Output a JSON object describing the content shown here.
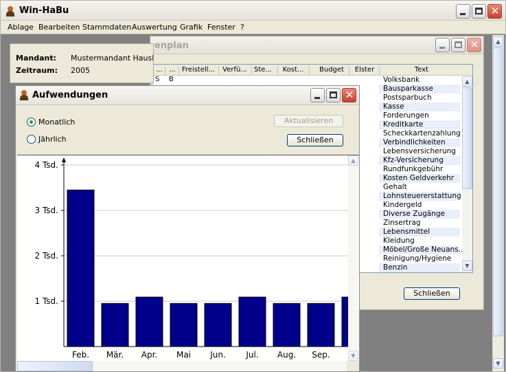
{
  "app": {
    "title": "Win-HaBu",
    "menu": [
      "Ablage",
      "Bearbeiten",
      "Stammdaten",
      "Auswertung",
      "Grafik",
      "Fenster",
      "?"
    ]
  },
  "info": {
    "mandant_label": "Mandant:",
    "mandant_value": "Mustermandant Haushalt",
    "zeitraum_label": "Zeitraum:",
    "zeitraum_value": "2005"
  },
  "kontenplan": {
    "title_partial": "enplan",
    "columns": [
      "...",
      "...",
      "Freistell...",
      "Verfü...",
      "Ste...",
      "Kost...",
      "Budget",
      "Elster",
      "Text"
    ],
    "first_row_marks": [
      "S",
      "B"
    ],
    "rows": [
      "Volksbank",
      "Bausparkasse",
      "Postsparbuch",
      "Kasse",
      "Forderungen",
      "Kreditkarte",
      "Scheckkartenzahlung",
      "Verbindlichkeiten",
      "Lebensversicherung",
      "Kfz-Versicherung",
      "Rundfunkgebühr",
      "Kosten Geldverkehr",
      "Gehalt",
      "Lohnsteuererstattung",
      "Kindergeld",
      "Diverse Zugänge",
      "Zinsertrag",
      "Lebensmittel",
      "Kleidung",
      "Möbel/Große Neuans...",
      "Reinigung/Hygiene",
      "Benzin"
    ],
    "close_button": "Schließen"
  },
  "aufwendungen": {
    "title": "Aufwendungen",
    "radio_monthly": "Monatlich",
    "radio_yearly": "Jährlich",
    "selected": "Monatlich",
    "refresh_button": "Aktualisieren",
    "close_button": "Schließen"
  },
  "chart_data": {
    "type": "bar",
    "categories": [
      "Feb.",
      "Mär.",
      "Apr.",
      "Mai",
      "Jun.",
      "Jul.",
      "Aug.",
      "Sep.",
      ""
    ],
    "values": [
      3450,
      950,
      1090,
      950,
      950,
      1090,
      950,
      950,
      1090
    ],
    "ylim": [
      0,
      4000
    ],
    "yticks": [
      1000,
      2000,
      3000,
      4000
    ],
    "ytick_labels": [
      "1 Tsd.",
      "2 Tsd.",
      "3 Tsd.",
      "4 Tsd."
    ],
    "title": "",
    "xlabel": "",
    "ylabel": "",
    "grid": true,
    "bar_color": "#00008b"
  },
  "colors": {
    "bar": "#00008b",
    "workspace": "#808080"
  }
}
